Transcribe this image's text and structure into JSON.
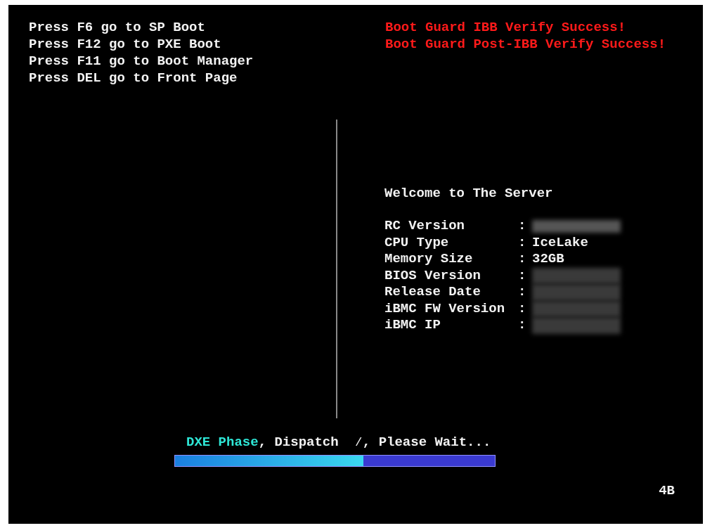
{
  "hotkeys": [
    "Press F6 go to SP Boot",
    "Press F12 go to PXE Boot",
    "Press F11 go to Boot Manager",
    "Press DEL go to Front Page"
  ],
  "messages": [
    "Boot Guard IBB Verify Success!",
    "Boot Guard Post-IBB Verify Success!"
  ],
  "welcome": "Welcome to The Server",
  "info": [
    {
      "label": "RC Version",
      "separator": ":"
    },
    {
      "label": "CPU Type",
      "separator": ":",
      "value": "IceLake"
    },
    {
      "label": "Memory Size",
      "separator": ":",
      "value": "32GB"
    },
    {
      "label": "BIOS Version",
      "separator": ":"
    },
    {
      "label": "Release Date",
      "separator": ":"
    },
    {
      "label": "iBMC FW Version",
      "separator": ":"
    },
    {
      "label": "iBMC IP",
      "separator": ":"
    }
  ],
  "status": {
    "phase": "DXE Phase",
    "rest": ", Dispatch  ⁄, Please Wait...",
    "level": 0.59
  },
  "post_code": "4B"
}
